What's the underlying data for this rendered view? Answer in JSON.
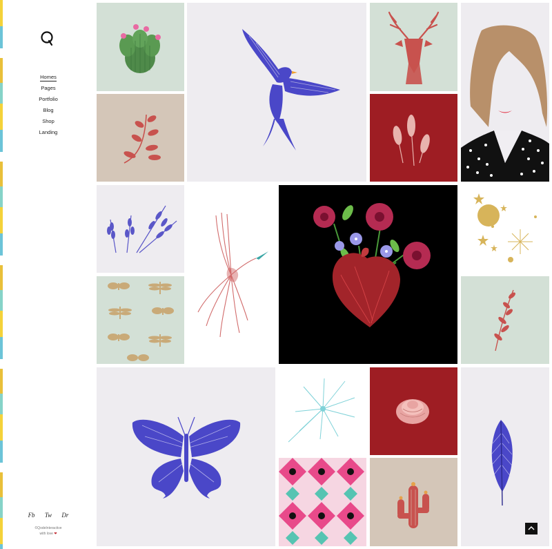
{
  "logo": {
    "icon": "q-logo-icon"
  },
  "menu": {
    "items": [
      {
        "label": "Homes",
        "active": true
      },
      {
        "label": "Pages"
      },
      {
        "label": "Portfolio"
      },
      {
        "label": "Blog"
      },
      {
        "label": "Shop"
      },
      {
        "label": "Landing"
      }
    ]
  },
  "social": {
    "links": [
      "Fb",
      "Tw",
      "Dr"
    ]
  },
  "footer": {
    "copyright": "©QodeInteractive",
    "tagline": "with love",
    "heart_icon": "heart-icon"
  },
  "gallery": {
    "tiles": [
      {
        "name": "cactus-tile",
        "bg": "#d3e0d6"
      },
      {
        "name": "swallow-tile",
        "bg": "#eeecf0"
      },
      {
        "name": "deer-tile",
        "bg": "#d3e0d6"
      },
      {
        "name": "woman-tile",
        "bg": "#eeecf0"
      },
      {
        "name": "red-branch-tile",
        "bg": "#d4c6b8"
      },
      {
        "name": "wheat-tile",
        "bg": "#9e1d23"
      },
      {
        "name": "lavender-tile",
        "bg": "#eeecf0"
      },
      {
        "name": "heron-tile",
        "bg": "#ffffff"
      },
      {
        "name": "heart-flowers-tile",
        "bg": "#000000"
      },
      {
        "name": "sun-stars-tile",
        "bg": "#ffffff"
      },
      {
        "name": "dragonfly-pattern-tile",
        "bg": "#d3e0d6"
      },
      {
        "name": "leaf-sprig-tile",
        "bg": "#d3e0d6"
      },
      {
        "name": "butterfly-tile",
        "bg": "#eeecf0"
      },
      {
        "name": "dandelion-tile",
        "bg": "#ffffff"
      },
      {
        "name": "peony-tile",
        "bg": "#9e1d23"
      },
      {
        "name": "feather-tile",
        "bg": "#eeecf0"
      },
      {
        "name": "ikat-pattern-tile",
        "bg": "#ffffff"
      },
      {
        "name": "red-cactus-tile",
        "bg": "#d4c6b8"
      }
    ]
  },
  "back_to_top": {
    "icon": "chevron-up-icon"
  }
}
